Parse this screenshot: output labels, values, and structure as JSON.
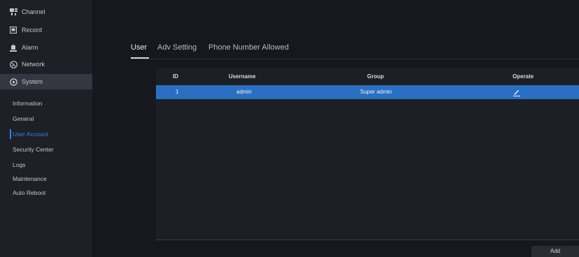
{
  "sidebar": {
    "items": [
      {
        "label": "Channel",
        "icon": "channel-icon"
      },
      {
        "label": "Record",
        "icon": "record-icon"
      },
      {
        "label": "Alarm",
        "icon": "alarm-icon"
      },
      {
        "label": "Network",
        "icon": "network-icon"
      },
      {
        "label": "System",
        "icon": "gear-icon"
      }
    ],
    "subitems": [
      {
        "label": "Information"
      },
      {
        "label": "General"
      },
      {
        "label": "User Account"
      },
      {
        "label": "Security Center"
      },
      {
        "label": "Logs"
      },
      {
        "label": "Maintenance"
      },
      {
        "label": "Auto Reboot"
      }
    ],
    "active_item": "System",
    "active_subitem": "User Account"
  },
  "tabs": [
    {
      "label": "User"
    },
    {
      "label": "Adv Setting"
    },
    {
      "label": "Phone Number Allowed"
    }
  ],
  "active_tab": "User",
  "table": {
    "headers": [
      "ID",
      "Username",
      "Group",
      "Operate"
    ],
    "rows": [
      {
        "id": "1",
        "username": "admin",
        "group": "Super admin"
      }
    ]
  },
  "add_label": "Add",
  "colors": {
    "accent": "#3c82d6",
    "row_selected": "#2a6fc2",
    "background": "#17181d"
  }
}
